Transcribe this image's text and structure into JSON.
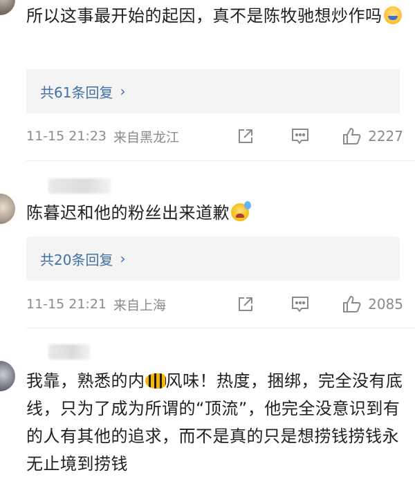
{
  "comments": [
    {
      "text": "所以这事最开始的起因，真不是陈牧驰想炒作吗",
      "emoji_icon": "grinning-sweat-emoji-icon",
      "replies_label": "共61条回复",
      "time": "11-15 21:23",
      "location": "来自黑龙江",
      "likes": "2227"
    },
    {
      "text": "陈暮迟和他的粉丝出来道歉",
      "emoji_icon": "sweating-face-emoji-icon",
      "replies_label": "共20条回复",
      "time": "11-15 21:21",
      "location": "来自上海",
      "likes": "2085"
    },
    {
      "text_before_emoji": "我靠，熟悉的内",
      "emoji_icon": "fish-emoji-icon",
      "text_after_emoji": "风味！热度，捆绑，完全没有底线，只为了成为所谓的“顶流”，他完全没意识到有的人有其他的追求，而不是真的只是想捞钱捞钱永无止境到捞钱"
    }
  ],
  "colors": {
    "link_blue": "#3f6fa6",
    "meta_gray": "#8a8a8a",
    "reply_box_bg": "#f4f4f4"
  }
}
